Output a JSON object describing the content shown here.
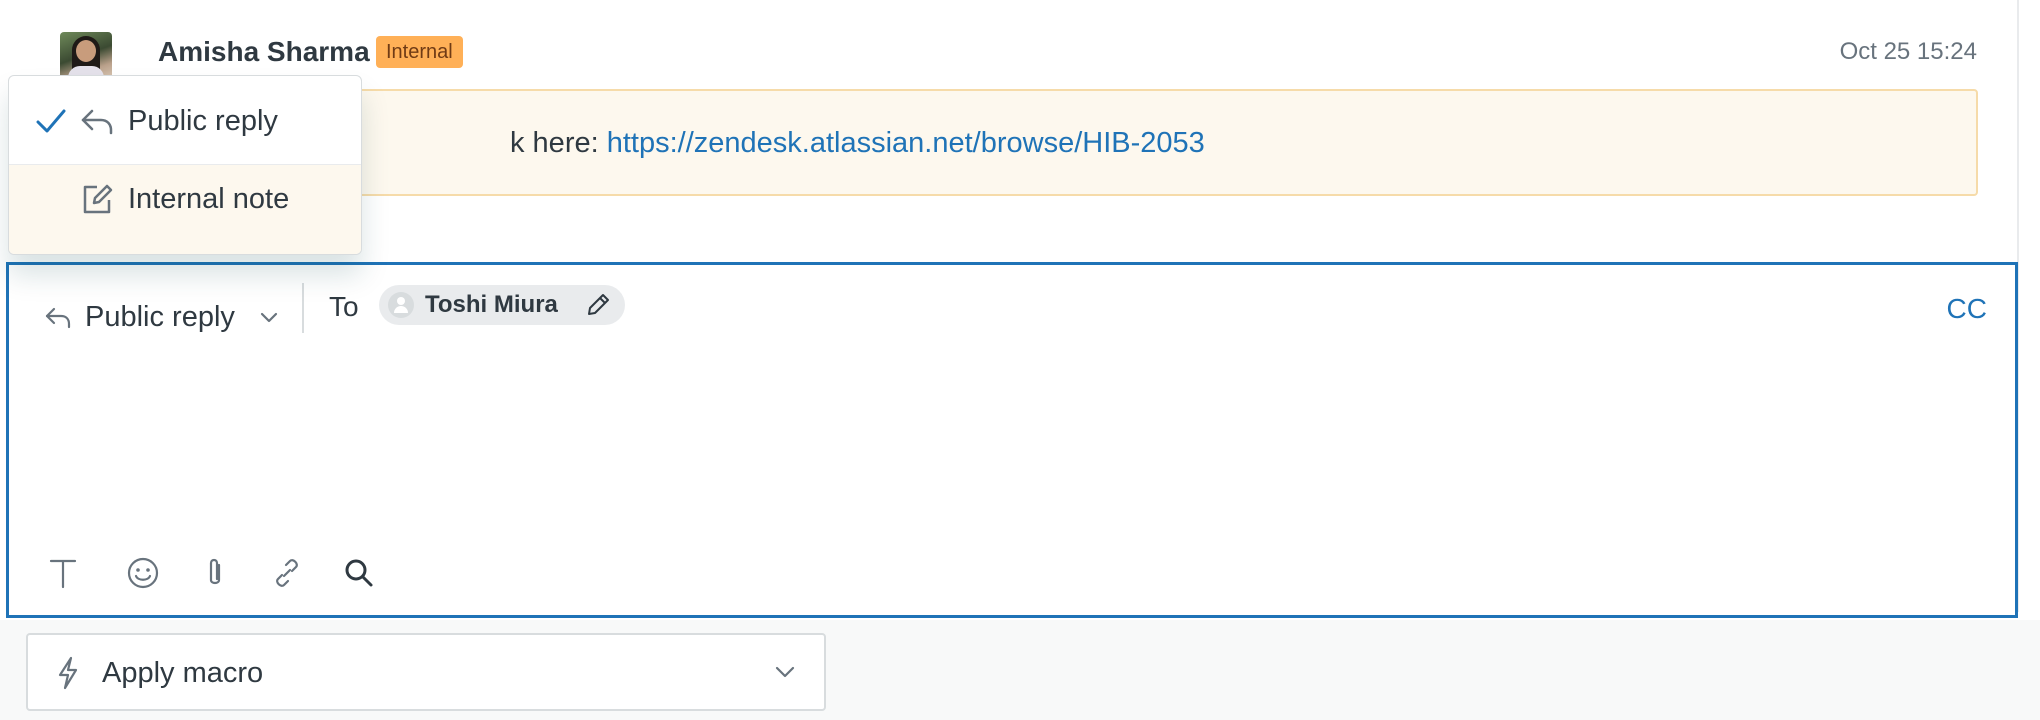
{
  "comment": {
    "author": "Amisha Sharma",
    "badge": "Internal",
    "timestamp": "Oct 25 15:24",
    "text_prefix": "k here: ",
    "link": "https://zendesk.atlassian.net/browse/HIB-2053"
  },
  "menu": {
    "items": [
      {
        "label": "Public reply",
        "selected": true,
        "icon": "reply-icon"
      },
      {
        "label": "Internal note",
        "selected": false,
        "icon": "note-edit-icon"
      }
    ]
  },
  "composer": {
    "reply_type": "Public reply",
    "to_label": "To",
    "recipient": "Toshi Miura",
    "cc_label": "CC",
    "toolbar": [
      "text-format-icon",
      "emoji-icon",
      "attachment-icon",
      "link-icon",
      "search-icon"
    ]
  },
  "macro": {
    "label": "Apply macro"
  },
  "colors": {
    "accent": "#1f73b7",
    "internal_badge": "#ffb057",
    "internal_note_bg": "#fdf8ee",
    "internal_note_border": "#f6dba9"
  }
}
